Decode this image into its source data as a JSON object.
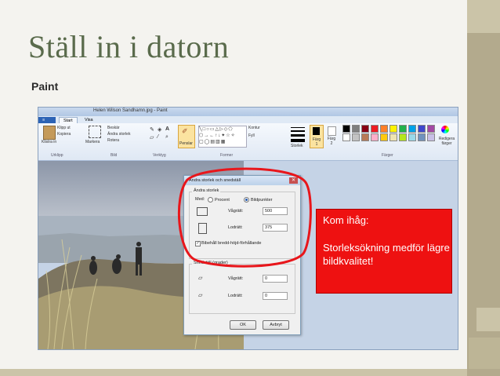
{
  "slide": {
    "title": "Ställ in i datorn",
    "subtitle": "Paint"
  },
  "paint": {
    "window_title": "Helen Wilson Sandhamn.jpg - Paint",
    "tabs": [
      "Start",
      "Visa"
    ],
    "ribbon": {
      "clipboard": {
        "paste": "Klistra in",
        "cut": "Klipp ut",
        "copy": "Kopiera",
        "group": "Urklipp"
      },
      "image": {
        "select": "Markera",
        "crop": "Beskär",
        "resize": "Ändra storlek",
        "rotate": "Rotera",
        "group": "Bild"
      },
      "tools": {
        "group": "Verktyg"
      },
      "brushes": "Penslar",
      "shapes": {
        "outline": "Kontur",
        "fill": "Fyll",
        "group": "Former"
      },
      "size": "Storlek",
      "color1": "Färg 1",
      "color2": "Färg 2",
      "edit_colors": "Redigera färger",
      "colors_group": "Färger"
    },
    "palette": [
      "#000000",
      "#7f7f7f",
      "#880015",
      "#ed1c24",
      "#ff7f27",
      "#fff200",
      "#22b14c",
      "#00a2e8",
      "#3f48cc",
      "#a349a4",
      "#ffffff",
      "#c3c3c3",
      "#b97a57",
      "#ffaec9",
      "#ffc90e",
      "#efe4b0",
      "#b5e61d",
      "#99d9ea",
      "#7092be",
      "#c8bfe7"
    ]
  },
  "dialog": {
    "title": "Ändra storlek och snedställ",
    "resize_label": "Ändra storlek",
    "by_label": "Med:",
    "percent": "Procent",
    "pixels": "Bildpunkter",
    "horizontal": "Vågrätt:",
    "vertical": "Lodrätt:",
    "width_value": "500",
    "height_value": "375",
    "keep_ratio": "Bibehåll bredd-höjd-förhållande",
    "skew_label": "Snedställ (grader)",
    "skew_h": "0",
    "skew_v": "0",
    "ok": "OK",
    "cancel": "Avbryt"
  },
  "note": {
    "line1": "Kom ihåg:",
    "line2": "Storleksökning medför lägre bildkvalitet!"
  },
  "colors": {
    "accent_red": "#ee1111",
    "title_green": "#5a6b4c",
    "side_band": "#b3aa8d"
  }
}
